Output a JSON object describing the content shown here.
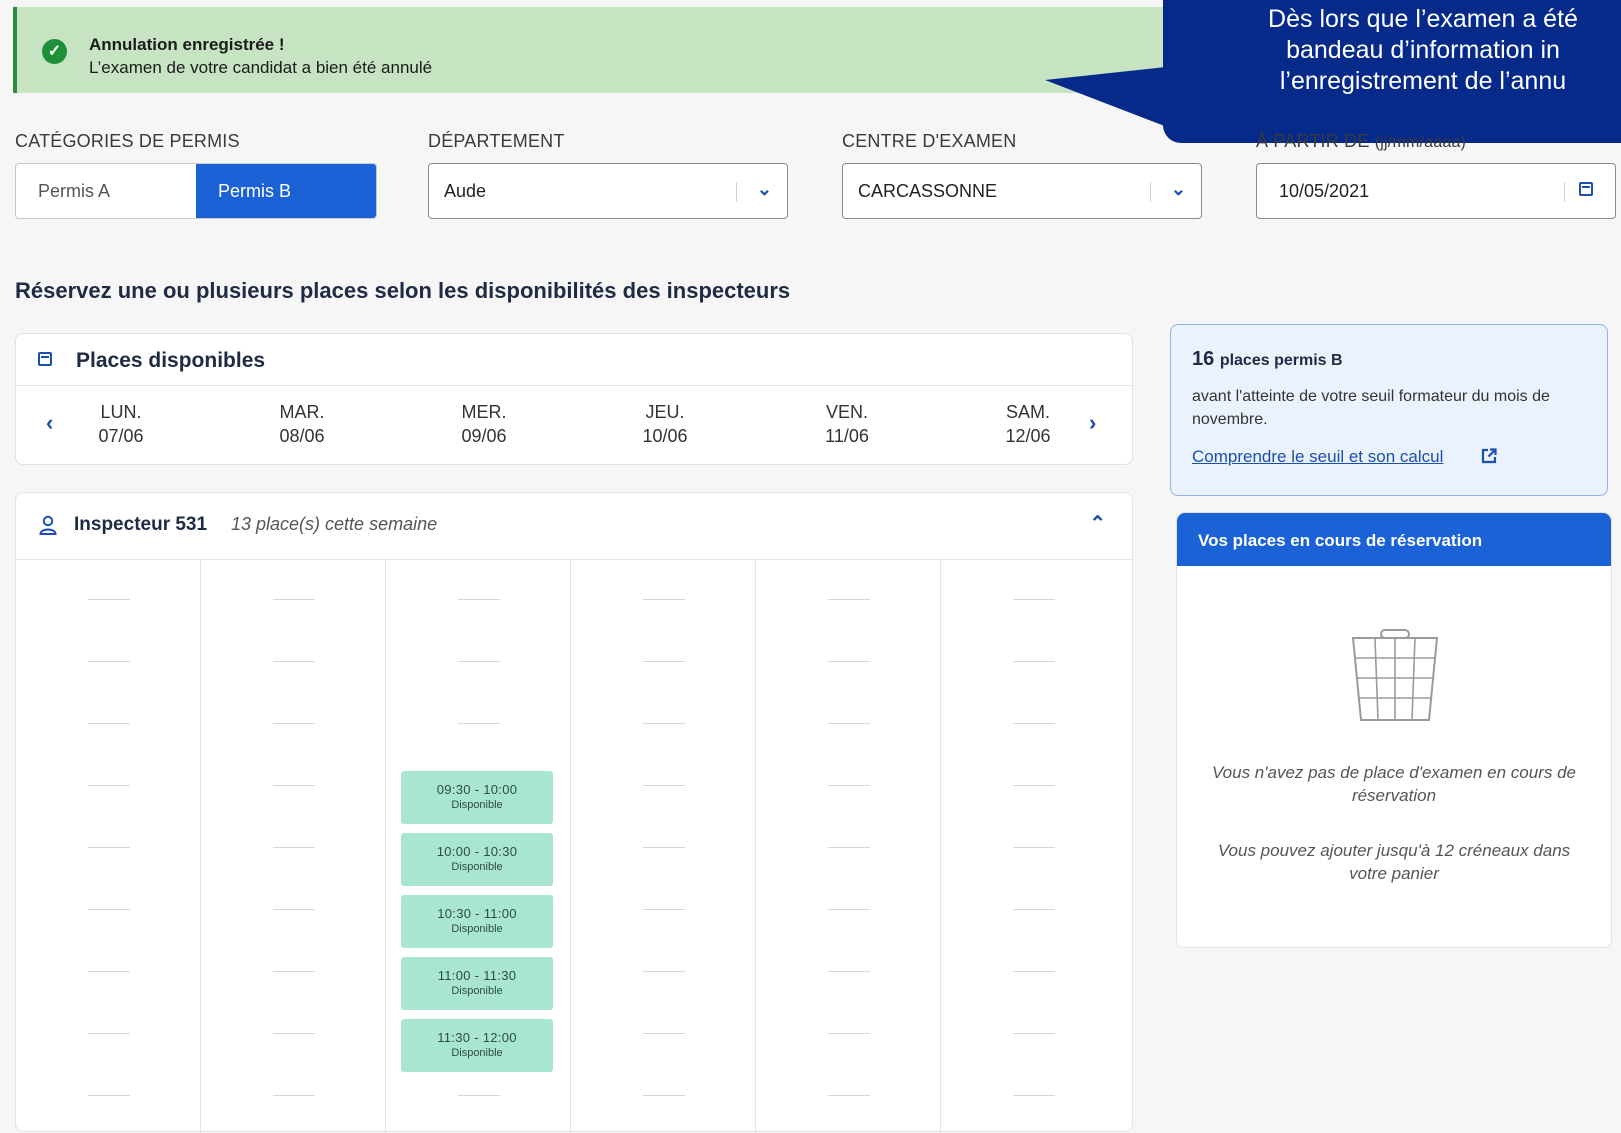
{
  "banner": {
    "title": "Annulation enregistrée !",
    "message": "L’examen de votre candidat a bien été annulé"
  },
  "callout": {
    "lines": [
      "Dès lors que l’examen a été",
      "bandeau d’information in",
      "l’enregistrement de l’annu"
    ]
  },
  "filters": {
    "categories_label": "CATÉGORIES DE PERMIS",
    "categories": [
      "Permis A",
      "Permis B"
    ],
    "categories_selected": "Permis B",
    "departement_label": "DÉPARTEMENT",
    "departement_value": "Aude",
    "centre_label": "CENTRE D'EXAMEN",
    "centre_value": "CARCASSONNE",
    "date_label": "À PARTIR DE",
    "date_hint": "(jj/mm/aaaa)",
    "date_value": "10/05/2021"
  },
  "heading": "Réservez une ou plusieurs places selon les disponibilités des inspecteurs",
  "week": {
    "title": "Places disponibles",
    "days": [
      {
        "name": "LUN.",
        "date": "07/06"
      },
      {
        "name": "MAR.",
        "date": "08/06"
      },
      {
        "name": "MER.",
        "date": "09/06"
      },
      {
        "name": "JEU.",
        "date": "10/06"
      },
      {
        "name": "VEN.",
        "date": "11/06"
      },
      {
        "name": "SAM.",
        "date": "12/06"
      }
    ]
  },
  "inspector": {
    "name": "Inspecteur 531",
    "count": "13 place(s) cette semaine",
    "slots": [
      {
        "time": "09:30 - 10:00",
        "status": "Disponible"
      },
      {
        "time": "10:00 - 10:30",
        "status": "Disponible"
      },
      {
        "time": "10:30 - 11:00",
        "status": "Disponible"
      },
      {
        "time": "11:00 - 11:30",
        "status": "Disponible"
      },
      {
        "time": "11:30 - 12:00",
        "status": "Disponible"
      }
    ]
  },
  "threshold": {
    "count": "16",
    "unit": "places permis B",
    "text": "avant l'atteinte de votre seuil formateur du mois de novembre.",
    "link": "Comprendre le seuil et son calcul"
  },
  "cart": {
    "title": "Vos places en cours de réservation",
    "empty_message": "Vous n'avez pas de place d'examen en cours de réservation",
    "hint": "Vous pouvez ajouter jusqu'à 12 créneaux dans votre panier"
  },
  "colors": {
    "accent": "#1b62d6",
    "success_bg": "#c6e4c2",
    "slot_bg": "#a9e6cf",
    "callout_bg": "#062a8a"
  }
}
